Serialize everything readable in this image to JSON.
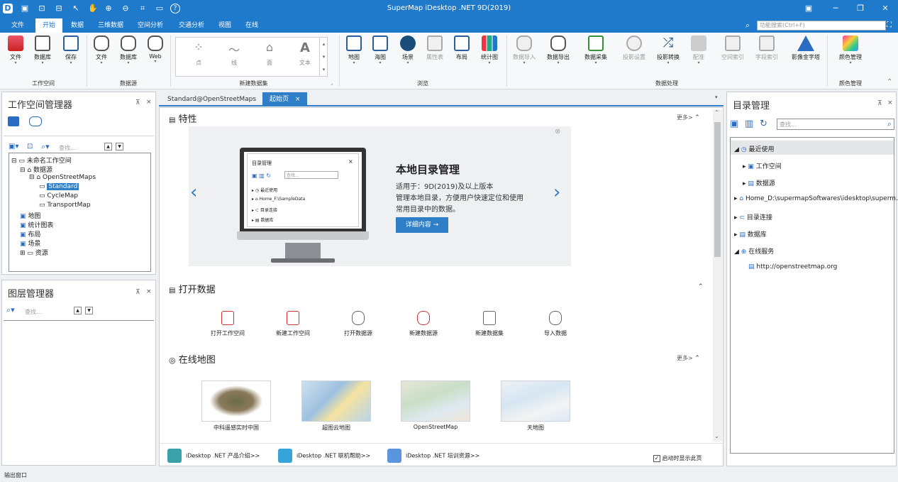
{
  "app": {
    "title": "SuperMap iDesktop .NET 9D(2019)"
  },
  "menu": {
    "items": [
      "文件",
      "开始",
      "数据",
      "三维数据",
      "空间分析",
      "交通分析",
      "视图",
      "在线"
    ],
    "active": "开始"
  },
  "function_search": {
    "placeholder": "功能搜索(Ctrl+F)"
  },
  "ribbon": {
    "workspace": {
      "buttons": [
        "文件",
        "数据库",
        "保存"
      ],
      "group": "工作空间"
    },
    "datasource": {
      "buttons": [
        "文件",
        "数据库",
        "Web"
      ],
      "group": "数据源"
    },
    "new_dataset": {
      "items": [
        "点",
        "线",
        "面",
        "文本"
      ],
      "group": "新建数据集"
    },
    "browse": {
      "buttons": [
        "地图",
        "海图",
        "场景",
        "属性表",
        "布局",
        "统计图"
      ],
      "group": "浏览"
    },
    "data_processing": {
      "buttons": [
        "数据导入",
        "数据导出",
        "数据采集",
        "投影设置",
        "投影转换",
        "配准",
        "空间索引",
        "字段索引",
        "影像金字塔"
      ],
      "group": "数据处理"
    },
    "color": {
      "buttons": [
        "颜色管理"
      ],
      "group": "颜色管理"
    }
  },
  "workspace_manager": {
    "title": "工作空间管理器",
    "search_placeholder": "查找...",
    "tree": {
      "root": "未命名工作空间",
      "datasources": "数据源",
      "osm": "OpenStreetMaps",
      "standard": "Standard",
      "cycle": "CycleMap",
      "transport": "TransportMap",
      "maps": "地图",
      "charts": "统计图表",
      "layouts": "布局",
      "scenes": "场景",
      "resources": "资源"
    }
  },
  "layer_manager": {
    "title": "图层管理器",
    "search_placeholder": "查找..."
  },
  "tabs": {
    "t1": "Standard@OpenStreetMaps",
    "t2": "起始页"
  },
  "start": {
    "features": {
      "title": "特性",
      "more": "更多>"
    },
    "banner": {
      "heading": "本地目录管理",
      "line1": "适用于：9D(2019)及以上版本",
      "line2": "管理本地目录，方便用户快速定位和使用",
      "line3": "常用目录中的数据。",
      "button": "详细内容 →",
      "mock": {
        "title": "目录管理",
        "search": "查找...",
        "i1": "最近使用",
        "i2": "Home_F:\\SampleData",
        "i3": "目录连接",
        "i4": "数据库"
      }
    },
    "open_data": {
      "title": "打开数据",
      "items": [
        "打开工作空间",
        "新建工作空间",
        "打开数据源",
        "新建数据源",
        "新建数据集",
        "导入数据"
      ]
    },
    "online_maps": {
      "title": "在线地图",
      "more": "更多>",
      "items": [
        "中科遥感实时中国",
        "超图云地图",
        "OpenStreetMap",
        "天地图"
      ]
    },
    "links": {
      "l1": "iDesktop .NET 产品介绍>>",
      "l2": "iDesktop .NET 联机帮助>>",
      "l3": "iDesktop .NET 培训资源>>"
    },
    "show_on_start": "启动时显示此页"
  },
  "catalog": {
    "title": "目录管理",
    "search_placeholder": "查找...",
    "tree": {
      "recent": "最近使用",
      "workspace": "工作空间",
      "datasource": "数据源",
      "home": "Home_D:\\supermapSoftwares\\idesktop\\superm...",
      "connections": "目录连接",
      "database": "数据库",
      "online": "在线服务",
      "osm_url": "http://openstreetmap.org"
    }
  },
  "status": {
    "output": "输出窗口"
  },
  "colors": {
    "accent": "#1f7acb",
    "banner_button": "#2f7fc8"
  }
}
